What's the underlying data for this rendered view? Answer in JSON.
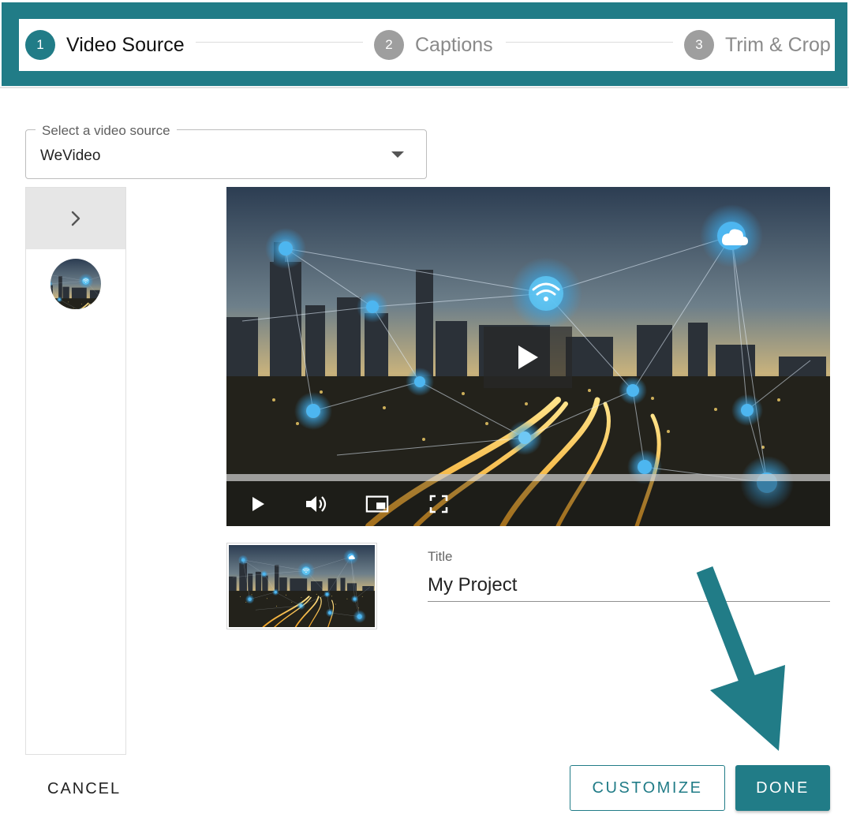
{
  "stepper": {
    "steps": [
      {
        "number": "1",
        "label": "Video Source",
        "state": "active"
      },
      {
        "number": "2",
        "label": "Captions",
        "state": "inactive"
      },
      {
        "number": "3",
        "label": "Trim & Crop",
        "state": "inactive"
      }
    ]
  },
  "source_select": {
    "label": "Select a video source",
    "value": "WeVideo"
  },
  "player": {
    "icons": [
      "chevron-right-icon",
      "play-icon",
      "volume-icon",
      "picture-in-picture-icon",
      "fullscreen-icon"
    ]
  },
  "title_field": {
    "label": "Title",
    "value": "My Project"
  },
  "buttons": {
    "cancel": "CANCEL",
    "customize": "CUSTOMIZE",
    "done": "DONE"
  },
  "colors": {
    "accent": "#217c87",
    "inactive_step": "#9e9e9e"
  }
}
